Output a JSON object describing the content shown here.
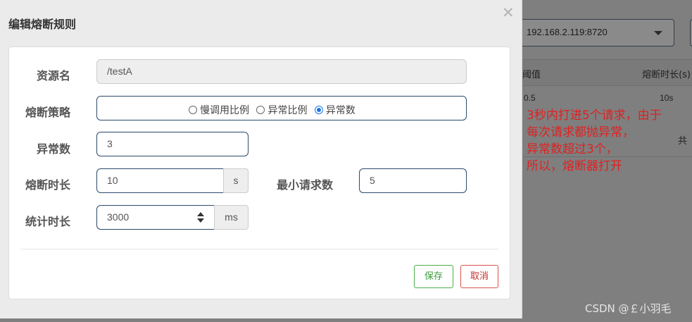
{
  "background": {
    "machine_select": "192.168.2.119:8720",
    "header_threshold": "阈值",
    "header_duration": "熔断时长(s)",
    "row_threshold": "0.5",
    "row_duration": "10s",
    "total_text": "共"
  },
  "annotation": {
    "lines": [
      "3秒内打进5个请求，由于",
      "每次请求都抛异常，",
      "异常数超过3个，",
      "所以，熔断器打开"
    ],
    "color": "#e02020"
  },
  "watermark": "CSDN @￡小羽毛",
  "modal": {
    "title": "编辑熔断规则",
    "close_icon": "close-icon",
    "resource": {
      "label": "资源名",
      "value": "/testA"
    },
    "strategy": {
      "label": "熔断策略",
      "options": [
        "慢调用比例",
        "异常比例",
        "异常数"
      ],
      "selected": "异常数"
    },
    "exception_count": {
      "label": "异常数",
      "value": "3"
    },
    "break_duration": {
      "label": "熔断时长",
      "value": "10",
      "unit": "s"
    },
    "min_requests": {
      "label": "最小请求数",
      "value": "5"
    },
    "stat_duration": {
      "label": "统计时长",
      "value": "3000",
      "unit": "ms"
    },
    "save_label": "保存",
    "cancel_label": "取消"
  },
  "colors": {
    "save": "#4cae4c",
    "cancel": "#d9534f",
    "focus_border": "#2c4a6b"
  }
}
